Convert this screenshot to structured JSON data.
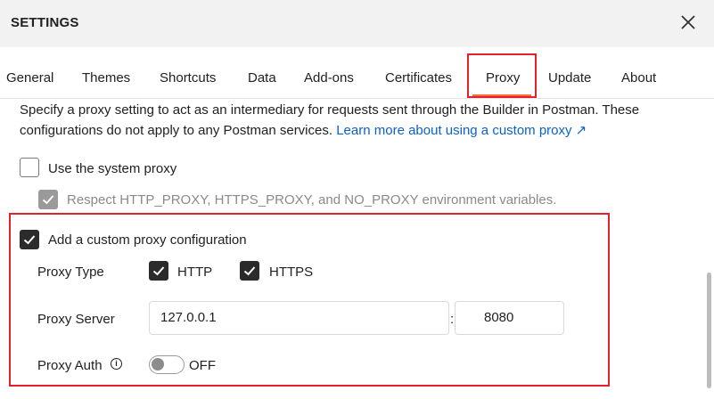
{
  "header": {
    "title": "SETTINGS"
  },
  "tabs": [
    {
      "label": "General"
    },
    {
      "label": "Themes"
    },
    {
      "label": "Shortcuts"
    },
    {
      "label": "Data"
    },
    {
      "label": "Add-ons"
    },
    {
      "label": "Certificates"
    },
    {
      "label": "Proxy",
      "active": true
    },
    {
      "label": "Update"
    },
    {
      "label": "About"
    }
  ],
  "proxy": {
    "description_line1": "Specify a proxy setting to act as an intermediary for requests sent through the Builder in Postman. These",
    "description_line2": "configurations do not apply to any Postman services.",
    "learn_more": "Learn more about using a custom proxy ↗",
    "system_proxy": {
      "label": "Use the system proxy",
      "checked": false
    },
    "respect_env": {
      "label": "Respect HTTP_PROXY, HTTPS_PROXY, and NO_PROXY environment variables.",
      "checked": true,
      "disabled": true
    },
    "custom_proxy": {
      "label": "Add a custom proxy configuration",
      "checked": true
    },
    "proxy_type": {
      "label": "Proxy Type",
      "http": {
        "label": "HTTP",
        "checked": true
      },
      "https": {
        "label": "HTTPS",
        "checked": true
      }
    },
    "proxy_server": {
      "label": "Proxy Server",
      "host": "127.0.0.1",
      "separator": ":",
      "port": "8080"
    },
    "proxy_auth": {
      "label": "Proxy Auth",
      "info": "i",
      "toggle_state": "OFF"
    }
  },
  "colors": {
    "accent": "#ff6c37",
    "highlight": "#e2212c",
    "link": "#0b61c8"
  }
}
